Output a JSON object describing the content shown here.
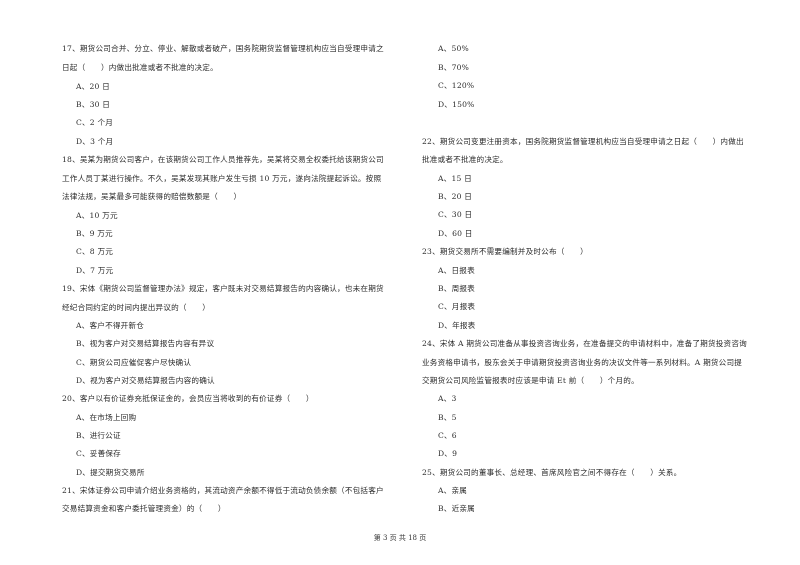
{
  "page": {
    "footer": "第 3 页 共 18 页"
  },
  "left_column": [
    {
      "number": "17",
      "stem_lines": [
        "17、期货公司合并、分立、停业、解散或者破产，国务院期货监督管理机构应当自受理申请之",
        "日起（　　）内做出批准或者不批准的决定。"
      ],
      "options": [
        "A、20 日",
        "B、30 日",
        "C、2 个月",
        "D、3 个月"
      ]
    },
    {
      "number": "18",
      "stem_lines": [
        "18、吴某为期货公司客户，在该期货公司工作人员推荐先，吴某将交易全权委托给该期货公司",
        "工作人员丁某进行操作。不久，吴某发现其账户发生亏损 10 万元，遂向法院提起诉讼。按照",
        "法律法规，吴某最多可能获得的赔偿数额是（　　）"
      ],
      "options": [
        "A、10 万元",
        "B、9 万元",
        "C、8 万元",
        "D、7 万元"
      ]
    },
    {
      "number": "19",
      "stem_lines": [
        "19、宋体《期货公司监督管理办法》规定，客户既未对交易结算报告的内容确认，也未在期货",
        "经纪合同约定的时间内提出异议的（　　）"
      ],
      "options": [
        "A、客户不得开新仓",
        "B、视为客户对交易结算报告内容有异议",
        "C、期货公司应催促客户尽快确认",
        "D、视为客户对交易结算报告内容的确认"
      ]
    },
    {
      "number": "20",
      "stem_lines": [
        "20、客户以有价证券充抵保证金的，会员应当将收到的有价证券（　　）"
      ],
      "options": [
        "A、在市场上回购",
        "B、进行公证",
        "C、妥善保存",
        "D、提交期货交易所"
      ]
    },
    {
      "number": "21",
      "stem_lines": [
        "21、宋体证券公司申请介绍业务资格的，其流动资产余额不得低于流动负债余额（不包括客户",
        "交易结算资金和客户委托管理资金）的（　　）"
      ],
      "options": []
    }
  ],
  "right_column": [
    {
      "number": "21-cont",
      "stem_lines": [],
      "options": [
        "A、50%",
        "B、70%",
        "C、120%",
        "D、150%"
      ]
    },
    {
      "number": "22",
      "stem_lines": [
        "22、期货公司变更注册资本，国务院期货监督管理机构应当自受理申请之日起（　　）内做出",
        "批准或者不批准的决定。"
      ],
      "options": [
        "A、15 日",
        "B、20 日",
        "C、30 日",
        "D、60 日"
      ]
    },
    {
      "number": "23",
      "stem_lines": [
        "23、期货交易所不需要编制并及时公布（　　）"
      ],
      "options": [
        "A、日报表",
        "B、周报表",
        "C、月报表",
        "D、年报表"
      ]
    },
    {
      "number": "24",
      "stem_lines": [
        "24、宋体 A 期货公司准备从事投资咨询业务，在准备提交的申请材料中，准备了期货投资咨询",
        "业务资格申请书，股东会关于申请期货投资咨询业务的决议文件等一系列材料。A 期货公司提",
        "交期货公司风险监管报表时应该是申请 Et 前（　　）个月的。"
      ],
      "options": [
        "A、3",
        "B、5",
        "C、6",
        "D、9"
      ]
    },
    {
      "number": "25",
      "stem_lines": [
        "25、期货公司的董事长、总经理、首席风险官之间不得存在（　　）关系。"
      ],
      "options": [
        "A、亲属",
        "B、近亲属"
      ]
    }
  ]
}
